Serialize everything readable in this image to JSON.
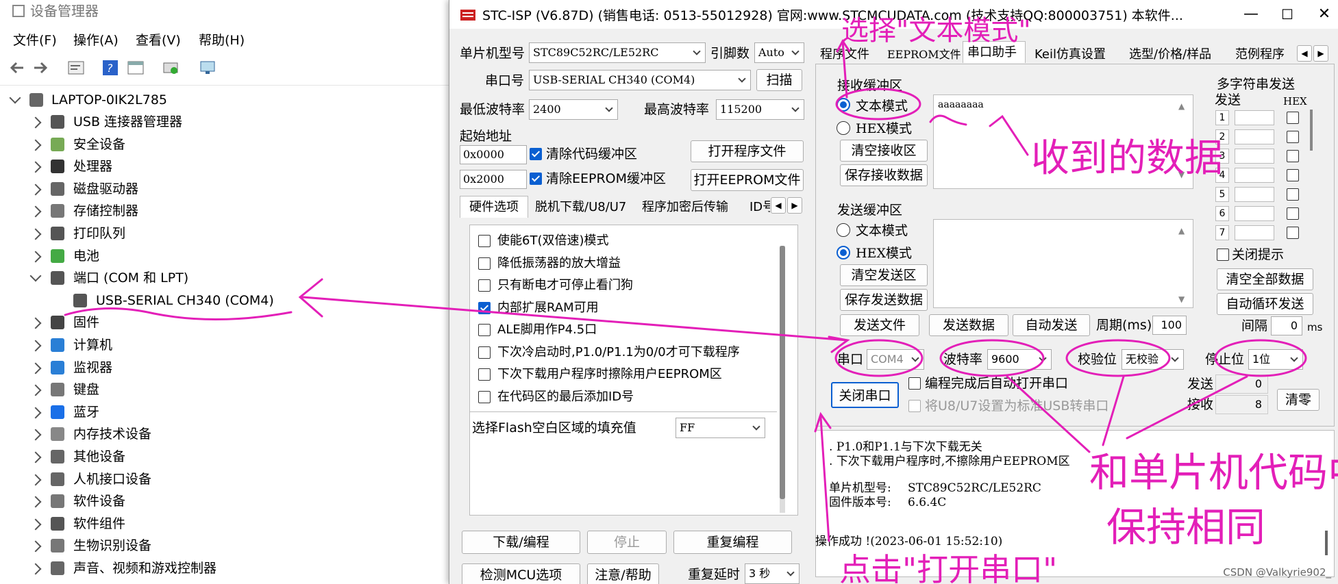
{
  "device_manager": {
    "title": "设备管理器",
    "menu": [
      "文件(F)",
      "操作(A)",
      "查看(V)",
      "帮助(H)"
    ],
    "root": "LAPTOP-0IK2L785",
    "categories": [
      {
        "label": "USB 连接器管理器",
        "icon": "usb-icon"
      },
      {
        "label": "安全设备",
        "icon": "key-icon"
      },
      {
        "label": "处理器",
        "icon": "cpu-icon"
      },
      {
        "label": "磁盘驱动器",
        "icon": "disk-icon"
      },
      {
        "label": "存储控制器",
        "icon": "storage-icon"
      },
      {
        "label": "打印队列",
        "icon": "printer-icon"
      },
      {
        "label": "电池",
        "icon": "battery-icon"
      },
      {
        "label": "端口 (COM 和 LPT)",
        "icon": "port-icon"
      },
      {
        "label": "USB-SERIAL CH340 (COM4)",
        "icon": "serial-icon"
      },
      {
        "label": "固件",
        "icon": "firmware-icon"
      },
      {
        "label": "计算机",
        "icon": "computer-icon"
      },
      {
        "label": "监视器",
        "icon": "monitor-icon"
      },
      {
        "label": "键盘",
        "icon": "keyboard-icon"
      },
      {
        "label": "蓝牙",
        "icon": "bluetooth-icon"
      },
      {
        "label": "内存技术设备",
        "icon": "memory-icon"
      },
      {
        "label": "其他设备",
        "icon": "other-device-icon"
      },
      {
        "label": "人机接口设备",
        "icon": "hid-icon"
      },
      {
        "label": "软件设备",
        "icon": "software-device-icon"
      },
      {
        "label": "软件组件",
        "icon": "software-component-icon"
      },
      {
        "label": "生物识别设备",
        "icon": "biometric-icon"
      },
      {
        "label": "声音、视频和游戏控制器",
        "icon": "audio-icon"
      }
    ]
  },
  "stc": {
    "title": "STC-ISP (V6.87D) (销售电话: 0513-55012928) 官网:www.STCMCUDATA.com  (技术支持QQ:800003751) 本软件...",
    "mcu_label": "单片机型号",
    "mcu_value": "STC89C52RC/LE52RC",
    "pins_label": "引脚数",
    "pins_value": "Auto",
    "port_label": "串口号",
    "port_value": "USB-SERIAL CH340 (COM4)",
    "scan_button": "扫描",
    "min_baud_label": "最低波特率",
    "min_baud_value": "2400",
    "max_baud_label": "最高波特率",
    "max_baud_value": "115200",
    "start_addr_label": "起始地址",
    "addr1": "0x0000",
    "clear_code_label": "清除代码缓冲区",
    "open_program_button": "打开程序文件",
    "addr2": "0x2000",
    "clear_eeprom_label": "清除EEPROM缓冲区",
    "open_eeprom_button": "打开EEPROM文件",
    "left_tabs": [
      "硬件选项",
      "脱机下载/U8/U7",
      "程序加密后传输",
      "ID号"
    ],
    "options": [
      {
        "label": "使能6T(双倍速)模式",
        "checked": false
      },
      {
        "label": "降低振荡器的放大增益",
        "checked": false
      },
      {
        "label": "只有断电才可停止看门狗",
        "checked": false
      },
      {
        "label": "内部扩展RAM可用",
        "checked": true
      },
      {
        "label": "ALE脚用作P4.5口",
        "checked": false
      },
      {
        "label": "下次冷启动时,P1.0/P1.1为0/0才可下载程序",
        "checked": false
      },
      {
        "label": "下次下载用户程序时擦除用户EEPROM区",
        "checked": false
      },
      {
        "label": "在代码区的最后添加ID号",
        "checked": false
      }
    ],
    "flash_fill_label": "选择Flash空白区域的填充值",
    "flash_fill_value": "FF",
    "download_button": "下载/编程",
    "stop_button": "停止",
    "reprogram_button": "重复编程",
    "detect_button": "检测MCU选项",
    "help_button": "注意/帮助",
    "repeat_delay_label": "重复延时",
    "repeat_delay_value": "3 秒",
    "right_tabs": [
      "程序文件",
      "EEPROM文件",
      "串口助手",
      "Keil仿真设置",
      "选型/价格/样品",
      "范例程序"
    ],
    "recv_group": "接收缓冲区",
    "recv_text_mode": "文本模式",
    "recv_hex_mode": "HEX模式",
    "clear_recv_button": "清空接收区",
    "save_recv_button": "保存接收数据",
    "recv_data": "aaaaaaaa",
    "send_group": "发送缓冲区",
    "send_text_mode": "文本模式",
    "send_hex_mode": "HEX模式",
    "clear_send_button": "清空发送区",
    "save_send_button": "保存发送数据",
    "send_file_button": "发送文件",
    "send_data_button": "发送数据",
    "auto_send_button": "自动发送",
    "period_label": "周期(ms)",
    "period_value": "100",
    "multi_group": "多字符串发送",
    "multi_send_header": "发送",
    "multi_hex_header": "HEX",
    "multi_rows": [
      "1",
      "2",
      "3",
      "4",
      "5",
      "6",
      "7"
    ],
    "close_tip_label": "关闭提示",
    "clear_all_button": "清空全部数据",
    "auto_loop_button": "自动循环发送",
    "interval_label": "间隔",
    "interval_value": "0",
    "interval_unit": "ms",
    "com_label": "串口",
    "com_value": "COM4",
    "baud_label": "波特率",
    "baud_value": "9600",
    "parity_label": "校验位",
    "parity_value": "无校验",
    "stop_bits_label": "停止位",
    "stop_bits_value": "1位",
    "close_port_button": "关闭串口",
    "auto_open_label": "编程完成后自动打开串口",
    "usb_serial_label": "将U8/U7设置为标准USB转串口",
    "sent_label": "发送",
    "sent_count": "0",
    "recv_label": "接收",
    "recv_count": "8",
    "clear_count_button": "清零",
    "log_line1": "P1.0和P1.1与下次下载无关",
    "log_line2": "下次下载用户程序时,不擦除用户EEPROM区",
    "log_mcu_label": "单片机型号:",
    "log_mcu_value": "STC89C52RC/LE52RC",
    "log_fw_label": "固件版本号:",
    "log_fw_value": "6.6.4C",
    "log_success": "操作成功 !(2023-06-01 15:52:10)"
  },
  "annotations": {
    "choose_text_mode": "选择\"文本模式\"",
    "received_data": "收到的数据",
    "keep_same": "和单片机代码中",
    "keep_same2": "保持相同",
    "click_open": "点击\"打开串口\""
  },
  "watermark": "CSDN @Valkyrie902_",
  "colors": {
    "annotation": "#e31fb8",
    "accent": "#0a5fd1"
  }
}
